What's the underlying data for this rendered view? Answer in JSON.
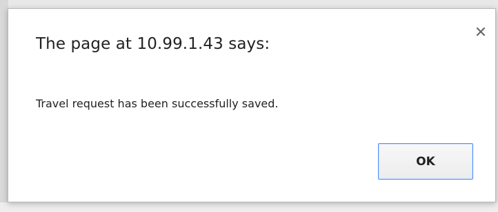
{
  "dialog": {
    "title": "The page at 10.99.1.43 says:",
    "message": "Travel request has been successfully saved.",
    "ok_label": "OK",
    "close_icon": "close-icon"
  },
  "colors": {
    "button_focus_border": "#4d90fe",
    "text": "#222222"
  }
}
